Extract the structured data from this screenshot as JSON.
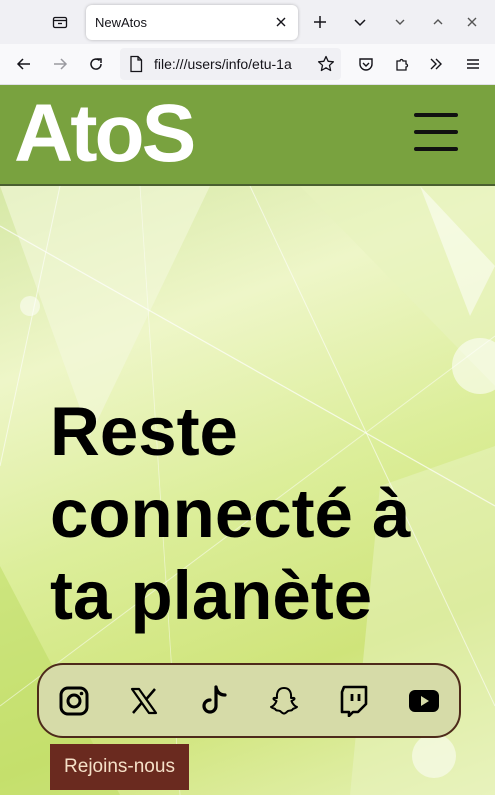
{
  "browser": {
    "tab_title": "NewAtos",
    "url": "file:///users/info/etu-1a"
  },
  "site": {
    "logo_text": "AtoS",
    "hero_lines": [
      "Reste",
      "connecté à",
      "ta planète"
    ],
    "join_label": "Rejoins-nous",
    "social": [
      "instagram-icon",
      "x-icon",
      "tiktok-icon",
      "snapchat-icon",
      "twitch-icon",
      "youtube-icon"
    ]
  },
  "colors": {
    "header": "#79a23f",
    "join_button": "#6a2a1f",
    "social_bar": "#d6dba8"
  }
}
